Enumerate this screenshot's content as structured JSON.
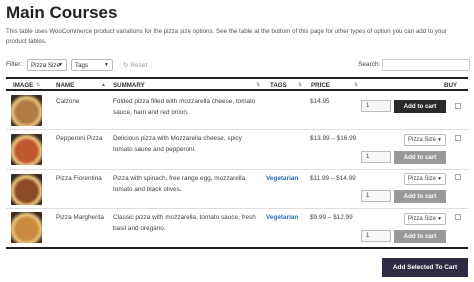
{
  "page": {
    "title": "Main Courses",
    "intro": "This table uses WooCommerce product variations for the pizza size options. See the table at the bottom of this page for other types of option you can add to your product tables."
  },
  "filters": {
    "label": "Filter:",
    "size_select": "Pizza Size",
    "tags_select": "Tags",
    "reset_label": "Reset",
    "search_label": "Search:",
    "search_value": ""
  },
  "table": {
    "headers": {
      "image": "IMAGE",
      "name": "NAME",
      "summary": "SUMMARY",
      "tags": "TAGS",
      "price": "PRICE",
      "buy": "BUY"
    },
    "rows": [
      {
        "name": "Calzone",
        "summary": "Folded pizza filled with mozzarella cheese, tomato sauce, ham and red onion.",
        "tags": "",
        "price": "$14.95",
        "option": "",
        "qty": "1",
        "cart_label": "Add to cart",
        "image_color": "#b07a45"
      },
      {
        "name": "Pepperoni Pizza",
        "summary": "Delicious pizza with Mozzarella cheese, spicy tomato sauce and pepperoni.",
        "tags": "",
        "price": "$13.99 – $16.99",
        "option": "Pizza Size",
        "qty": "1",
        "cart_label": "Add to cart",
        "image_color": "#c0572f"
      },
      {
        "name": "Pizza Fiorentina",
        "summary": "Pizza with spinach, free range egg, mozzarella, tomato and black olives.",
        "tags": "Vegetarian",
        "price": "$11.99 – $14.99",
        "option": "Pizza Size",
        "qty": "1",
        "cart_label": "Add to cart",
        "image_color": "#8a4a28"
      },
      {
        "name": "Pizza Margherita",
        "summary": "Classic pizza with mozzarella, tomato sauce, fresh basil and oregano.",
        "tags": "Vegetarian",
        "price": "$9.99 – $12.99",
        "option": "Pizza Size",
        "qty": "1",
        "cart_label": "Add to cart",
        "image_color": "#c9893f"
      }
    ]
  },
  "bulk_button": "Add Selected To Cart",
  "colors": {
    "tag_link": "#2a6db5",
    "cart_active": "#2a2a2a",
    "cart_disabled": "#999999",
    "bulk_button": "#2e2c45"
  }
}
